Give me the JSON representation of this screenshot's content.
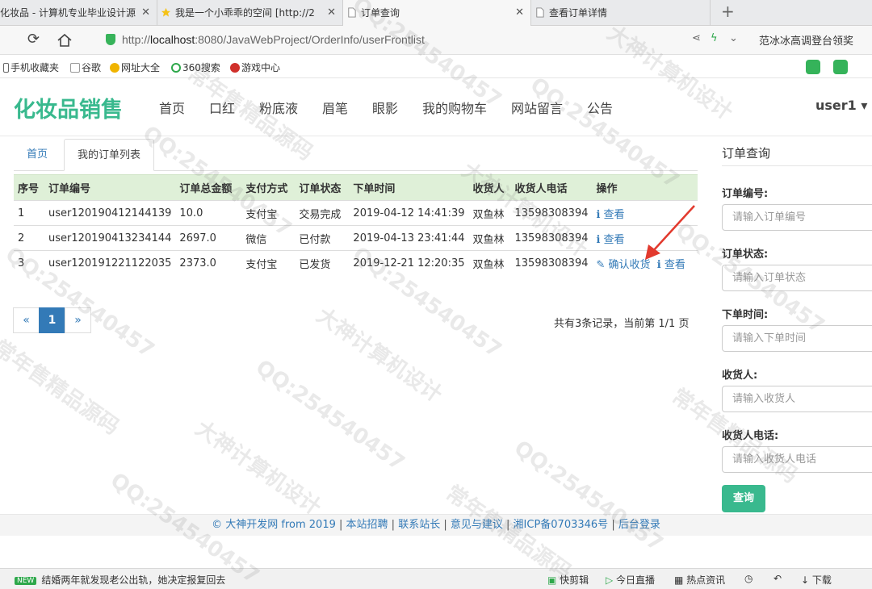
{
  "browser": {
    "tabs": [
      {
        "title": "化妆品 - 计算机专业毕业设计源",
        "close": "✕"
      },
      {
        "title": "我是一个小乖乖的空间 [http://2",
        "close": "✕"
      },
      {
        "title": "订单查询",
        "close": "✕"
      },
      {
        "title": "查看订单详情",
        "close": ""
      }
    ],
    "new_tab": "+",
    "url_prefix": "http://",
    "url_host": "localhost",
    "url_rest": ":8080/JavaWebProject/OrderInfo/userFrontlist",
    "right_text": "范冰冰高调登台领奖",
    "bookmarks": [
      "手机收藏夹",
      "谷歌",
      "网址大全",
      "360搜索",
      "游戏中心"
    ]
  },
  "navbar": {
    "brand": "化妆品销售",
    "items": [
      "首页",
      "口红",
      "粉底液",
      "眉笔",
      "眼影",
      "我的购物车",
      "网站留言",
      "公告"
    ],
    "user": "user1 ▾"
  },
  "main": {
    "tabs": {
      "home": "首页",
      "current": "我的订单列表"
    },
    "columns": [
      "序号",
      "订单编号",
      "订单总金额",
      "支付方式",
      "订单状态",
      "下单时间",
      "收货人",
      "收货人电话",
      "操作"
    ],
    "rows": [
      {
        "no": "1",
        "order_no": "user120190412144139",
        "amount": "10.0",
        "pay": "支付宝",
        "status": "交易完成",
        "time": "2019-04-12 14:41:39",
        "receiver": "双鱼林",
        "phone": "13598308394",
        "confirm": "",
        "view": "ℹ 查看"
      },
      {
        "no": "2",
        "order_no": "user120190413234144",
        "amount": "2697.0",
        "pay": "微信",
        "status": "已付款",
        "time": "2019-04-13 23:41:44",
        "receiver": "双鱼林",
        "phone": "13598308394",
        "confirm": "",
        "view": "ℹ 查看"
      },
      {
        "no": "3",
        "order_no": "user120191221122035",
        "amount": "2373.0",
        "pay": "支付宝",
        "status": "已发货",
        "time": "2019-12-21 12:20:35",
        "receiver": "双鱼林",
        "phone": "13598308394",
        "confirm": "✎ 确认收货",
        "view": "ℹ 查看"
      }
    ],
    "pager": {
      "prev": "«",
      "current": "1",
      "next": "»"
    },
    "record_info": "共有3条记录，当前第 1/1 页"
  },
  "sidebar": {
    "title": "订单查询",
    "fields": [
      {
        "label": "订单编号:",
        "placeholder": "请输入订单编号"
      },
      {
        "label": "订单状态:",
        "placeholder": "请输入订单状态"
      },
      {
        "label": "下单时间:",
        "placeholder": "请输入下单时间"
      },
      {
        "label": "收货人:",
        "placeholder": "请输入收货人"
      },
      {
        "label": "收货人电话:",
        "placeholder": "请输入收货人电话"
      }
    ],
    "submit": "查询"
  },
  "footer": {
    "links": [
      "© 大神开发网 from 2019",
      "本站招聘",
      "联系站长",
      "意见与建议",
      "湘ICP备0703346号",
      "后台登录"
    ]
  },
  "statusbar": {
    "new_tag": "NEW",
    "news": "结婚两年就发现老公出轨，她决定报复回去",
    "items": [
      "快剪辑",
      "今日直播",
      "热点资讯",
      "下载"
    ]
  },
  "watermarks": [
    "QQ:254540457",
    "大神计算机设计",
    "常年售精品源码"
  ],
  "colors": {
    "brand": "#39b98e",
    "link": "#337ab7",
    "table_header": "#dff0d8"
  }
}
